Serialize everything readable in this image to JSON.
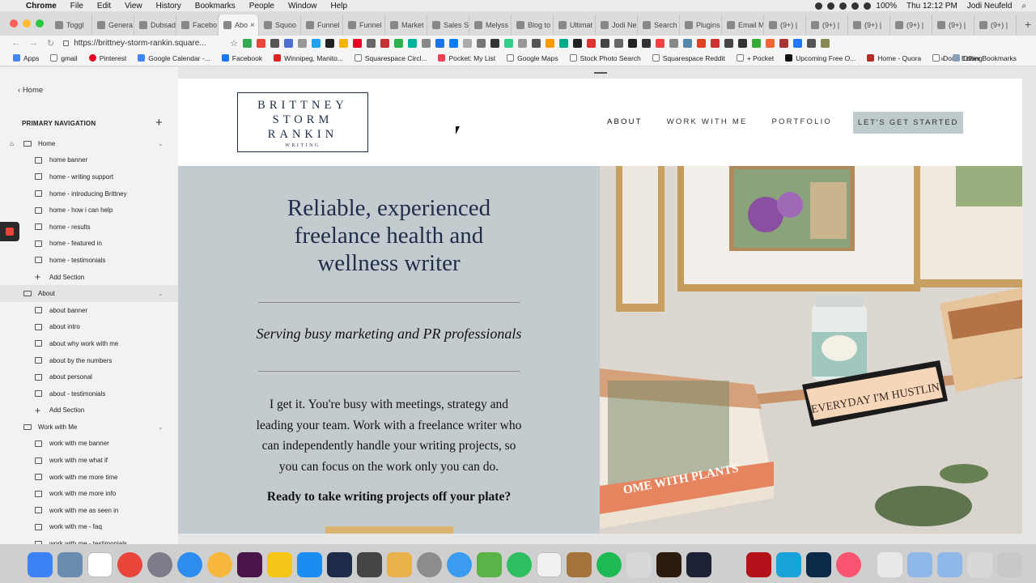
{
  "menubar": {
    "app": "Chrome",
    "items": [
      "File",
      "Edit",
      "View",
      "History",
      "Bookmarks",
      "People",
      "Window",
      "Help"
    ],
    "clock": "Thu 12:12 PM",
    "user": "Jodi Neufeld",
    "battery": "100%"
  },
  "tabs": [
    {
      "label": "Toggl"
    },
    {
      "label": "Genera"
    },
    {
      "label": "Dubsad"
    },
    {
      "label": "Facebo"
    },
    {
      "label": "Abo",
      "active": true
    },
    {
      "label": "Squoo"
    },
    {
      "label": "Funnel"
    },
    {
      "label": "Funnel"
    },
    {
      "label": "Market"
    },
    {
      "label": "Sales S"
    },
    {
      "label": "Melyss"
    },
    {
      "label": "Blog to"
    },
    {
      "label": "Ultimat"
    },
    {
      "label": "Jodi Ne"
    },
    {
      "label": "Search"
    },
    {
      "label": "Plugins"
    },
    {
      "label": "Email M"
    },
    {
      "label": "(9+) |"
    },
    {
      "label": "(9+) |"
    },
    {
      "label": "(9+) |"
    },
    {
      "label": "(9+) |"
    },
    {
      "label": "(9+) |"
    },
    {
      "label": "(9+) |"
    }
  ],
  "address": {
    "url": "https://brittney-storm-rankin.square..."
  },
  "bookmarks": [
    "Apps",
    "gmail",
    "Pinterest",
    "Google Calendar -...",
    "Facebook",
    "Winnipeg, Manito...",
    "Squarespace Circl...",
    "Pocket: My List",
    "Google Maps",
    "Stock Photo Search",
    "Squarespace Reddit",
    "+ Pocket",
    "Upcoming Free O...",
    "Home - Quora",
    "Done Editing"
  ],
  "bookmarks_other": "Other Bookmarks",
  "sidebar": {
    "back": "Home",
    "section_title": "PRIMARY NAVIGATION",
    "nav": [
      {
        "type": "page",
        "label": "Home",
        "home": true,
        "highlight": false
      },
      {
        "type": "section",
        "label": "home banner"
      },
      {
        "type": "section",
        "label": "home - writing support"
      },
      {
        "type": "section",
        "label": "home - introducing Brittney"
      },
      {
        "type": "section",
        "label": "home - how i can help"
      },
      {
        "type": "section",
        "label": "home - results"
      },
      {
        "type": "section",
        "label": "home - featured in"
      },
      {
        "type": "section",
        "label": "home - testimonials"
      },
      {
        "type": "add",
        "label": "Add Section"
      },
      {
        "type": "page",
        "label": "About",
        "highlight": true
      },
      {
        "type": "section",
        "label": "about banner"
      },
      {
        "type": "section",
        "label": "about intro"
      },
      {
        "type": "section",
        "label": "about why work with me"
      },
      {
        "type": "section",
        "label": "about by the numbers"
      },
      {
        "type": "section",
        "label": "about personal"
      },
      {
        "type": "section",
        "label": "about - testimonials"
      },
      {
        "type": "add",
        "label": "Add Section"
      },
      {
        "type": "page",
        "label": "Work with Me",
        "highlight": false
      },
      {
        "type": "section",
        "label": "work with me banner"
      },
      {
        "type": "section",
        "label": "work with me what if"
      },
      {
        "type": "section",
        "label": "work with me more time"
      },
      {
        "type": "section",
        "label": "work with me more info"
      },
      {
        "type": "section",
        "label": "work with me as seen in"
      },
      {
        "type": "section",
        "label": "work with me - faq"
      },
      {
        "type": "section",
        "label": "work with me - testimonials"
      }
    ]
  },
  "site": {
    "logo": {
      "line1": "BRITTNEY",
      "line2": "STORM",
      "line3": "RANKIN",
      "line4": "WRITING"
    },
    "nav": [
      "ABOUT",
      "WORK WITH ME",
      "PORTFOLIO"
    ],
    "cta": "LET'S GET STARTED",
    "hero": {
      "title": "Reliable, experienced freelance health and wellness writer",
      "subtitle": "Serving busy marketing and PR professionals",
      "body": "I get it. You're busy with meetings, strategy and leading your team. Work with a freelance writer who can independently handle your writing projects, so you can focus on the work only you can do.",
      "ready": "Ready to take writing projects off your plate?"
    },
    "photo": {
      "sign_text": "EVERYDAY I'M HUSTLIN'",
      "book_text": "OME WITH PLANTS"
    }
  },
  "colors": {
    "navy": "#1f2d4a",
    "hero_bg": "#c4cbce",
    "cta_bg": "#bfcacd",
    "gold": "#d9b46e"
  }
}
